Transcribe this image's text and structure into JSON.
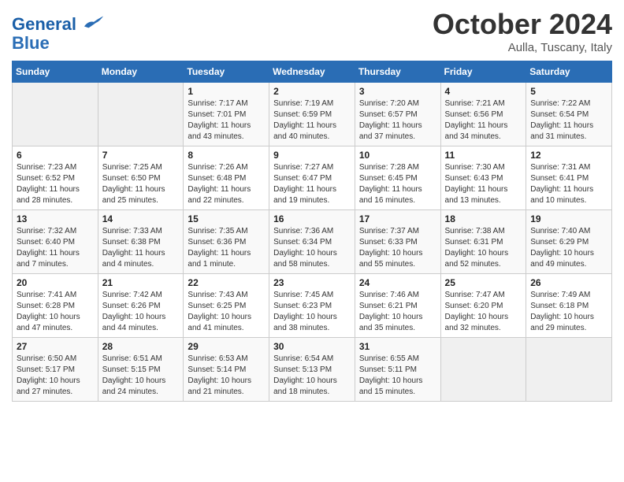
{
  "header": {
    "logo_line1": "General",
    "logo_line2": "Blue",
    "month": "October 2024",
    "location": "Aulla, Tuscany, Italy"
  },
  "days_of_week": [
    "Sunday",
    "Monday",
    "Tuesday",
    "Wednesday",
    "Thursday",
    "Friday",
    "Saturday"
  ],
  "weeks": [
    [
      {
        "day": "",
        "info": ""
      },
      {
        "day": "",
        "info": ""
      },
      {
        "day": "1",
        "info": "Sunrise: 7:17 AM\nSunset: 7:01 PM\nDaylight: 11 hours and 43 minutes."
      },
      {
        "day": "2",
        "info": "Sunrise: 7:19 AM\nSunset: 6:59 PM\nDaylight: 11 hours and 40 minutes."
      },
      {
        "day": "3",
        "info": "Sunrise: 7:20 AM\nSunset: 6:57 PM\nDaylight: 11 hours and 37 minutes."
      },
      {
        "day": "4",
        "info": "Sunrise: 7:21 AM\nSunset: 6:56 PM\nDaylight: 11 hours and 34 minutes."
      },
      {
        "day": "5",
        "info": "Sunrise: 7:22 AM\nSunset: 6:54 PM\nDaylight: 11 hours and 31 minutes."
      }
    ],
    [
      {
        "day": "6",
        "info": "Sunrise: 7:23 AM\nSunset: 6:52 PM\nDaylight: 11 hours and 28 minutes."
      },
      {
        "day": "7",
        "info": "Sunrise: 7:25 AM\nSunset: 6:50 PM\nDaylight: 11 hours and 25 minutes."
      },
      {
        "day": "8",
        "info": "Sunrise: 7:26 AM\nSunset: 6:48 PM\nDaylight: 11 hours and 22 minutes."
      },
      {
        "day": "9",
        "info": "Sunrise: 7:27 AM\nSunset: 6:47 PM\nDaylight: 11 hours and 19 minutes."
      },
      {
        "day": "10",
        "info": "Sunrise: 7:28 AM\nSunset: 6:45 PM\nDaylight: 11 hours and 16 minutes."
      },
      {
        "day": "11",
        "info": "Sunrise: 7:30 AM\nSunset: 6:43 PM\nDaylight: 11 hours and 13 minutes."
      },
      {
        "day": "12",
        "info": "Sunrise: 7:31 AM\nSunset: 6:41 PM\nDaylight: 11 hours and 10 minutes."
      }
    ],
    [
      {
        "day": "13",
        "info": "Sunrise: 7:32 AM\nSunset: 6:40 PM\nDaylight: 11 hours and 7 minutes."
      },
      {
        "day": "14",
        "info": "Sunrise: 7:33 AM\nSunset: 6:38 PM\nDaylight: 11 hours and 4 minutes."
      },
      {
        "day": "15",
        "info": "Sunrise: 7:35 AM\nSunset: 6:36 PM\nDaylight: 11 hours and 1 minute."
      },
      {
        "day": "16",
        "info": "Sunrise: 7:36 AM\nSunset: 6:34 PM\nDaylight: 10 hours and 58 minutes."
      },
      {
        "day": "17",
        "info": "Sunrise: 7:37 AM\nSunset: 6:33 PM\nDaylight: 10 hours and 55 minutes."
      },
      {
        "day": "18",
        "info": "Sunrise: 7:38 AM\nSunset: 6:31 PM\nDaylight: 10 hours and 52 minutes."
      },
      {
        "day": "19",
        "info": "Sunrise: 7:40 AM\nSunset: 6:29 PM\nDaylight: 10 hours and 49 minutes."
      }
    ],
    [
      {
        "day": "20",
        "info": "Sunrise: 7:41 AM\nSunset: 6:28 PM\nDaylight: 10 hours and 47 minutes."
      },
      {
        "day": "21",
        "info": "Sunrise: 7:42 AM\nSunset: 6:26 PM\nDaylight: 10 hours and 44 minutes."
      },
      {
        "day": "22",
        "info": "Sunrise: 7:43 AM\nSunset: 6:25 PM\nDaylight: 10 hours and 41 minutes."
      },
      {
        "day": "23",
        "info": "Sunrise: 7:45 AM\nSunset: 6:23 PM\nDaylight: 10 hours and 38 minutes."
      },
      {
        "day": "24",
        "info": "Sunrise: 7:46 AM\nSunset: 6:21 PM\nDaylight: 10 hours and 35 minutes."
      },
      {
        "day": "25",
        "info": "Sunrise: 7:47 AM\nSunset: 6:20 PM\nDaylight: 10 hours and 32 minutes."
      },
      {
        "day": "26",
        "info": "Sunrise: 7:49 AM\nSunset: 6:18 PM\nDaylight: 10 hours and 29 minutes."
      }
    ],
    [
      {
        "day": "27",
        "info": "Sunrise: 6:50 AM\nSunset: 5:17 PM\nDaylight: 10 hours and 27 minutes."
      },
      {
        "day": "28",
        "info": "Sunrise: 6:51 AM\nSunset: 5:15 PM\nDaylight: 10 hours and 24 minutes."
      },
      {
        "day": "29",
        "info": "Sunrise: 6:53 AM\nSunset: 5:14 PM\nDaylight: 10 hours and 21 minutes."
      },
      {
        "day": "30",
        "info": "Sunrise: 6:54 AM\nSunset: 5:13 PM\nDaylight: 10 hours and 18 minutes."
      },
      {
        "day": "31",
        "info": "Sunrise: 6:55 AM\nSunset: 5:11 PM\nDaylight: 10 hours and 15 minutes."
      },
      {
        "day": "",
        "info": ""
      },
      {
        "day": "",
        "info": ""
      }
    ]
  ]
}
